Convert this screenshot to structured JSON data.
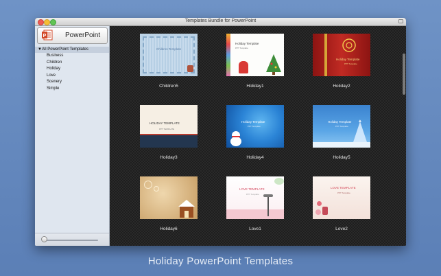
{
  "window": {
    "title": "Templates Bundle for PowerPoint"
  },
  "sidebar": {
    "app_button_label": "PowerPoint",
    "root_label": "All PowerPoint Templates",
    "categories": [
      "Business",
      "Children",
      "Holiday",
      "Love",
      "Scenery",
      "Simple"
    ]
  },
  "templates": [
    {
      "name": "Children5",
      "thumb_title": "Children Template",
      "thumb_sub": ""
    },
    {
      "name": "Holiday1",
      "thumb_title": "Holiday Template",
      "thumb_sub": "PPT Template"
    },
    {
      "name": "Holiday2",
      "thumb_title": "Holiday Template",
      "thumb_sub": "PPT Template"
    },
    {
      "name": "Holiday3",
      "thumb_title": "HOLIDAY TEMPLATE",
      "thumb_sub": "PPT TEMPLATE"
    },
    {
      "name": "Holiday4",
      "thumb_title": "Holiday Template",
      "thumb_sub": "PPT Template"
    },
    {
      "name": "Holiday5",
      "thumb_title": "Holiday Template",
      "thumb_sub": "PPT Template"
    },
    {
      "name": "Holiday6",
      "thumb_title": "",
      "thumb_sub": ""
    },
    {
      "name": "Love1",
      "thumb_title": "LOVE TEMPLATE",
      "thumb_sub": "PPT Template"
    },
    {
      "name": "Love2",
      "thumb_title": "LOVE TEMPLATE",
      "thumb_sub": "PPT Template"
    }
  ],
  "banner": "Holiday PowerPoint Templates",
  "colors": {
    "desktop": "#6a8fc3",
    "sidebar": "#dfe6ef",
    "content_bg": "#1e1e1e",
    "powerpoint_brand": "#d24726"
  }
}
